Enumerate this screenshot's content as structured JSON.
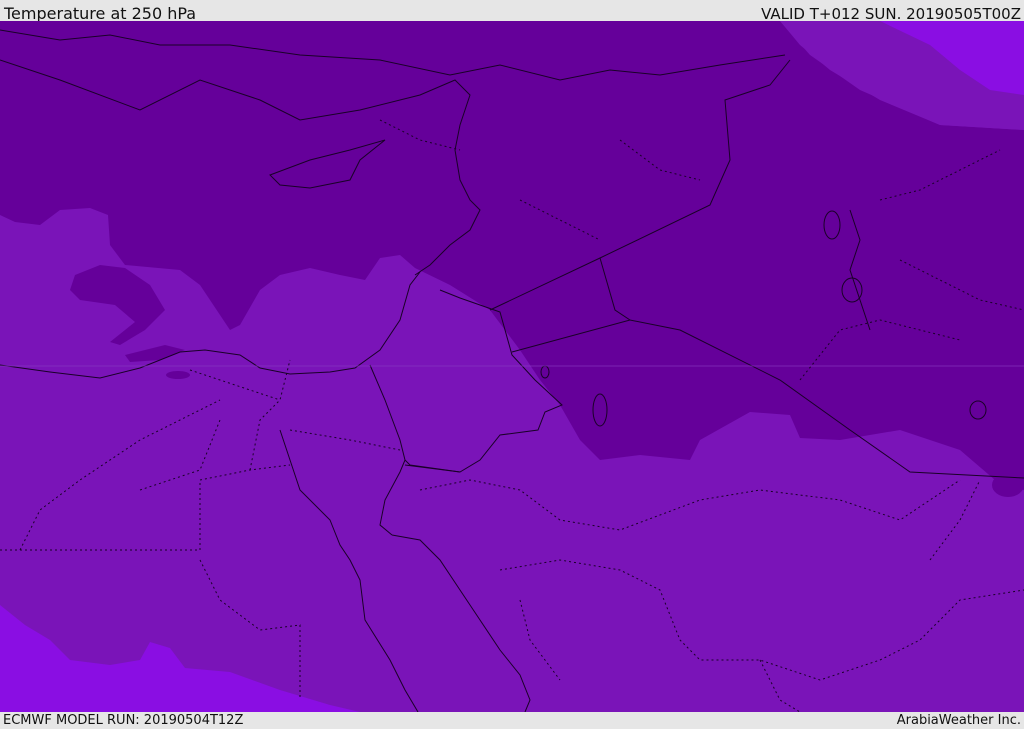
{
  "header": {
    "title": "Temperature at 250 hPa",
    "valid_time": "VALID T+012 SUN. 20190505T00Z"
  },
  "footer": {
    "model_run": "ECMWF MODEL RUN: 20190504T12Z",
    "credit": "ArabiaWeather Inc."
  },
  "colors": {
    "cold_fill": "#65009a",
    "mid_fill": "#7a14b8",
    "warm_fill": "#8a0ee3",
    "coastline": "#1a0028",
    "border": "#1a0028"
  }
}
